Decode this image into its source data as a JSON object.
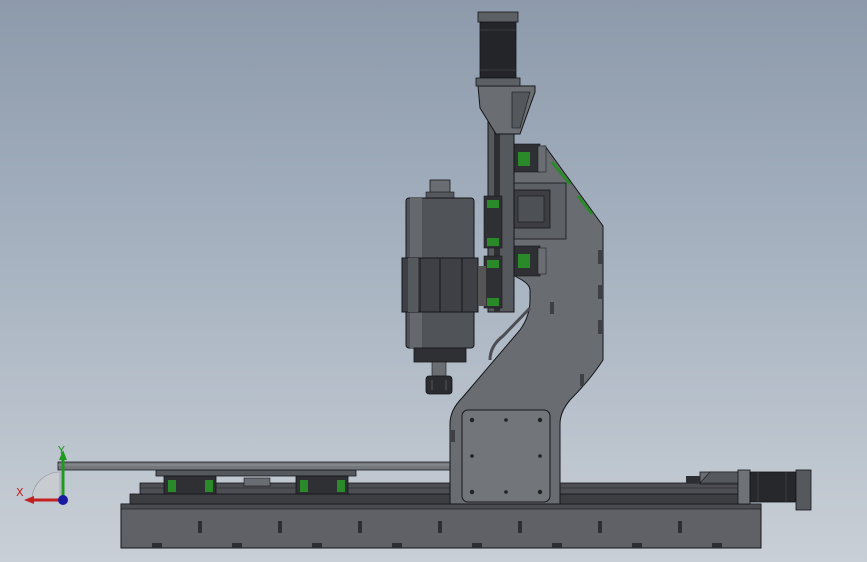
{
  "triad": {
    "x_label": "X",
    "y_label": "Y",
    "x_color": "#c42020",
    "y_color": "#1f9a1f",
    "z_color": "#1a1aa0"
  },
  "colors": {
    "part_dark": "#3f4146",
    "part_mid": "#5b5e63",
    "part_light": "#7a7d82",
    "edge": "#15161a",
    "rail_accent": "#2a8a2a"
  }
}
